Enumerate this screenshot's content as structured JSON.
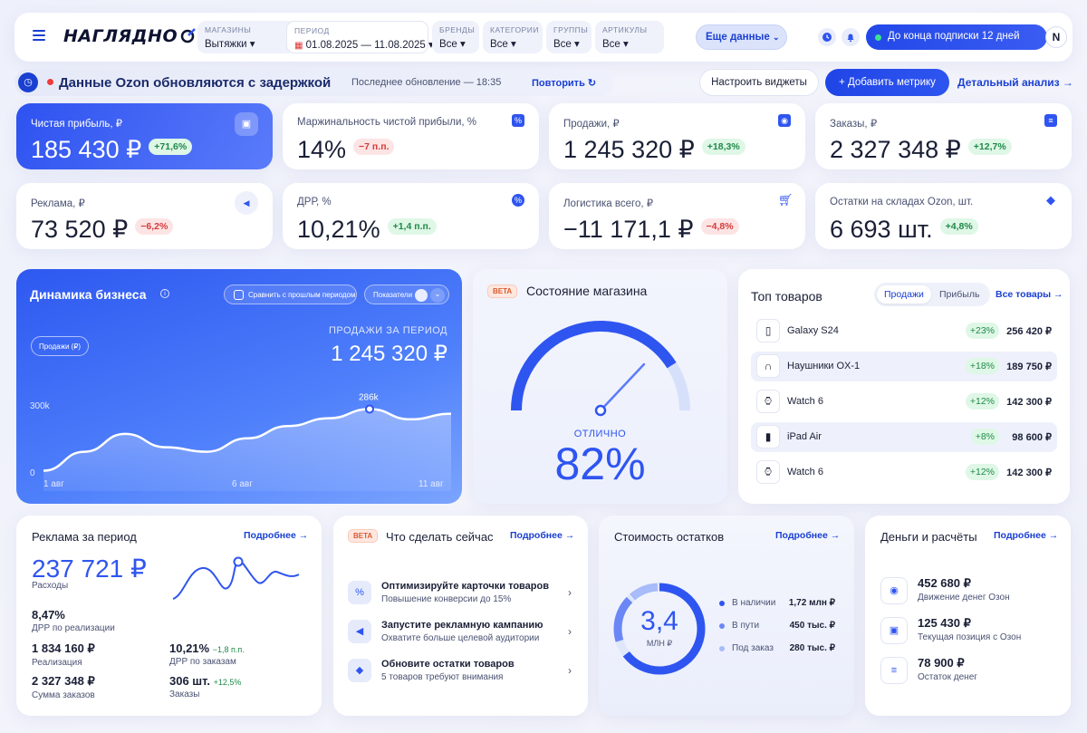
{
  "topbar": {
    "logo": "НАГЛЯДНО",
    "filters": [
      {
        "label": "МАГАЗИНЫ",
        "value": "Вытяжки ▾"
      },
      {
        "label": "ПЕРИОД",
        "value": "01.08.2025 — 11.08.2025 ▾"
      },
      {
        "label": "БРЕНДЫ",
        "value": "Все ▾"
      },
      {
        "label": "КАТЕГОРИИ",
        "value": "Все ▾"
      },
      {
        "label": "ГРУППЫ",
        "value": "Все ▾"
      },
      {
        "label": "АРТИКУЛЫ",
        "value": "Все ▾"
      }
    ],
    "more_data": "Еще данные",
    "subscription": "До конца подписки 12 дней",
    "avatar": "N"
  },
  "alert": {
    "text": "Данные Ozon обновляются с задержкой",
    "last_update": "Последнее обновление — 18:35",
    "retry": "Повторить"
  },
  "actions": {
    "configure": "Настроить виджеты",
    "add_metric": "+ Добавить метрику",
    "detail": "Детальный анализ"
  },
  "kpis": [
    {
      "title": "Чистая прибыль, ₽",
      "value": "185 430 ₽",
      "delta": "+71,6%",
      "dir": "up"
    },
    {
      "title": "Маржинальность чистой прибыли, %",
      "value": "14%",
      "delta": "−7 п.п.",
      "dir": "down"
    },
    {
      "title": "Продажи, ₽",
      "value": "1 245 320 ₽",
      "delta": "+18,3%",
      "dir": "up"
    },
    {
      "title": "Заказы, ₽",
      "value": "2 327 348 ₽",
      "delta": "+12,7%",
      "dir": "up"
    },
    {
      "title": "Реклама, ₽",
      "value": "73 520 ₽",
      "delta": "−6,2%",
      "dir": "down"
    },
    {
      "title": "ДРР, %",
      "value": "10,21%",
      "delta": "+1,4 п.п.",
      "dir": "up"
    },
    {
      "title": "Логистика всего, ₽",
      "value": "−11 171,1 ₽",
      "delta": "−4,8%",
      "dir": "down"
    },
    {
      "title": "Остатки на складах Ozon, шт.",
      "value": "6 693 шт.",
      "delta": "+4,8%",
      "dir": "up"
    }
  ],
  "dynamics": {
    "title": "Динамика бизнеса",
    "compare": "Сравнить с прошлым периодом",
    "indicators": "Показатели",
    "series_pill": "Продажи (₽)",
    "sales_label": "ПРОДАЖИ ЗА ПЕРИОД",
    "sales_value": "1 245 320 ₽",
    "chart_data": {
      "type": "area",
      "x": [
        "1 авг",
        "2 авг",
        "3 авг",
        "4 авг",
        "5 авг",
        "6 авг",
        "7 авг",
        "8 авг",
        "9 авг",
        "10 авг",
        "11 авг"
      ],
      "x_ticks": [
        "1 авг",
        "6 авг",
        "11 авг"
      ],
      "y_ticks": [
        "0",
        "300k"
      ],
      "values": [
        10,
        95,
        175,
        115,
        95,
        155,
        210,
        245,
        286,
        240,
        265
      ],
      "highlight_label": "286k",
      "highlight_index": 8,
      "ylim": [
        0,
        300
      ]
    }
  },
  "gauge": {
    "beta": "BETA",
    "title": "Состояние магазина",
    "label": "ОТЛИЧНО",
    "value": "82%",
    "percent": 82
  },
  "top_products": {
    "title": "Топ товаров",
    "tab_sales": "Продажи",
    "tab_profit": "Прибыль",
    "all": "Все товары →",
    "rows": [
      {
        "name": "Galaxy S24",
        "pct": "+23%",
        "sum": "256 420 ₽",
        "icon": "phone-icon"
      },
      {
        "name": "Наушники OX-1",
        "pct": "+18%",
        "sum": "189 750 ₽",
        "icon": "headphones-icon"
      },
      {
        "name": "Watch 6",
        "pct": "+12%",
        "sum": "142 300 ₽",
        "icon": "watch-icon"
      },
      {
        "name": "iPad Air",
        "pct": "+8%",
        "sum": "98 600 ₽",
        "icon": "tablet-icon"
      },
      {
        "name": "Watch 6",
        "pct": "+12%",
        "sum": "142 300 ₽",
        "icon": "watch-icon"
      }
    ]
  },
  "ads": {
    "title": "Реклама за период",
    "more": "Подробнее →",
    "expense_value": "237 721 ₽",
    "expense_label": "Расходы",
    "drr_sales_value": "8,47%",
    "drr_sales_label": "ДРР по реализации",
    "realization_value": "1 834 160 ₽",
    "realization_label": "Реализация",
    "drr_orders_value": "10,21%",
    "drr_orders_delta": "−1,8 п.п.",
    "drr_orders_label": "ДРР по заказам",
    "orders_sum_value": "2 327 348 ₽",
    "orders_sum_label": "Сумма заказов",
    "orders_value": "306 шт.",
    "orders_delta": "+12,5%",
    "orders_label": "Заказы"
  },
  "todo": {
    "beta": "BETA",
    "title": "Что сделать сейчас",
    "more": "Подробнее →",
    "items": [
      {
        "title": "Оптимизируйте карточки товаров",
        "sub": "Повышение конверсии до 15%"
      },
      {
        "title": "Запустите рекламную кампанию",
        "sub": "Охватите больше целевой аудитории"
      },
      {
        "title": "Обновите остатки товаров",
        "sub": "5 товаров требуют внимания"
      }
    ]
  },
  "stock_cost": {
    "title": "Стоимость остатков",
    "more": "Подробнее →",
    "center_value": "3,4",
    "center_unit": "МЛН ₽",
    "legend": [
      {
        "label": "В наличии",
        "value": "1,72 млн ₽",
        "color": "#2f55f0"
      },
      {
        "label": "В пути",
        "value": "450 тыс. ₽",
        "color": "#6b87f6"
      },
      {
        "label": "Под заказ",
        "value": "280 тыс. ₽",
        "color": "#a8bbfa"
      }
    ]
  },
  "money": {
    "title": "Деньги и расчёты",
    "more": "Подробнее →",
    "items": [
      {
        "value": "452 680 ₽",
        "label": "Движение денег Озон"
      },
      {
        "value": "125 430 ₽",
        "label": "Текущая позиция с Озон"
      },
      {
        "value": "78 900 ₽",
        "label": "Остаток денег"
      }
    ]
  }
}
